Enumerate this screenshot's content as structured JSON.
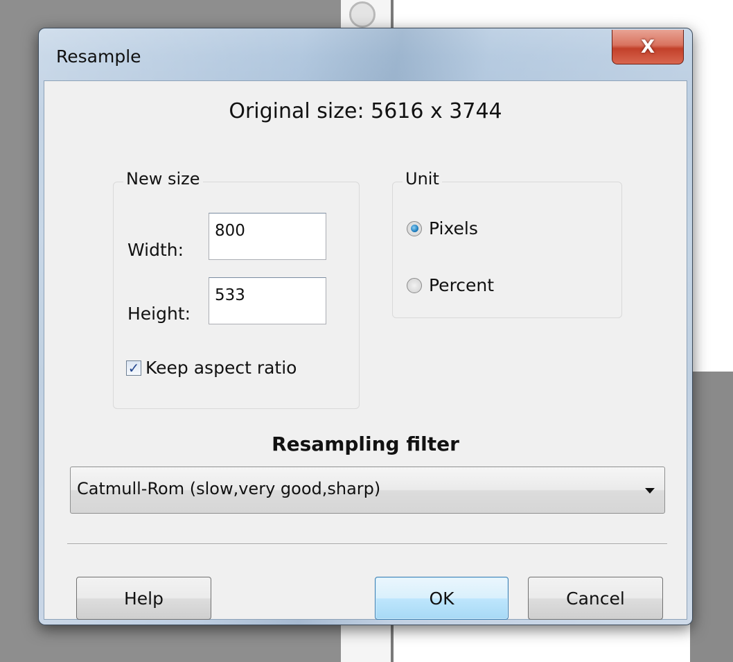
{
  "window": {
    "title": "Resample",
    "close_glyph": "X"
  },
  "original_size": "Original size: 5616 x 3744",
  "new_size": {
    "legend": "New size",
    "width_label": "Width:",
    "width_value": "800",
    "height_label": "Height:",
    "height_value": "533",
    "keep_aspect_label": "Keep aspect ratio",
    "keep_aspect_checked": true
  },
  "unit": {
    "legend": "Unit",
    "options": [
      {
        "label": "Pixels",
        "selected": true
      },
      {
        "label": "Percent",
        "selected": false
      }
    ]
  },
  "resampling": {
    "title": "Resampling filter",
    "selected": "Catmull-Rom (slow,very good,sharp)"
  },
  "buttons": {
    "help": "Help",
    "ok": "OK",
    "cancel": "Cancel"
  },
  "icons": {
    "close": "close-icon",
    "checkbox_check": "✓",
    "dropdown": "chevron-down-icon"
  },
  "colors": {
    "ok_border": "#3c7fb1",
    "close_red": "#c2402a",
    "radio_selected": "#1f7fbf"
  }
}
